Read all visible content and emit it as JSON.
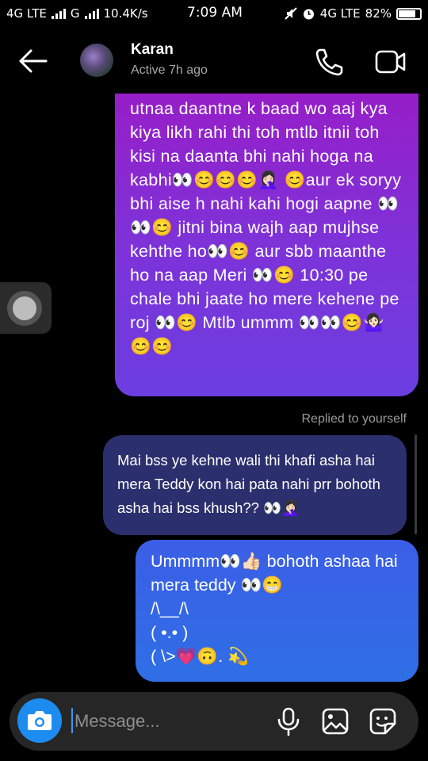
{
  "status_bar": {
    "left_network": "4G LTE",
    "left_network2": "G",
    "speed": "10.4K/s",
    "time": "7:09 AM",
    "right_network": "4G LTE",
    "battery": "82%",
    "battery_level": 0.82
  },
  "header": {
    "contact_name": "Karan",
    "contact_status": "Active 7h ago",
    "icons": [
      "back-arrow-icon",
      "phone-icon",
      "video-camera-icon"
    ]
  },
  "messages": [
    {
      "sender": "me",
      "text": "utnaa daantne k baad wo aaj kya kiya likh rahi thi toh mtlb itnii toh kisi na daanta bhi nahi hoga na kabhi👀😊😊😊🤦🏻‍♀️ 😊aur ek soryy bhi aise h nahi kahi hogi aapne 👀👀😊 jitni bina wajh aap mujhse kehthe ho👀😊 aur sbb maanthe ho na aap Meri 👀😊 10:30 pe chale bhi jaate ho mere kehene pe roj 👀😊 Mtlb ummm 👀👀😊🤷🏻‍♀️ 😊😊"
    },
    {
      "sender": "me",
      "replied_label": "Replied to yourself",
      "text": "Mai bss ye kehne wali thi khafi asha hai mera Teddy kon hai pata nahi prr bohoth asha hai bss khush?? 👀🤦🏻‍♀️"
    },
    {
      "sender": "me",
      "text": "Ummmm👀👍🏻 bohoth ashaa hai mera teddy 👀😁\n/\\__/\\\n( •.• )\n( \\>💗🙃. 💫"
    }
  ],
  "composer": {
    "placeholder": "Message...",
    "icons": [
      "camera-icon",
      "microphone-icon",
      "gallery-icon",
      "sticker-icon"
    ]
  },
  "colors": {
    "camera_button": "#1d8cf0",
    "bubble1_top": "#9a1bc6",
    "bubble1_bottom": "#6b3ee0",
    "bubble2": "#2c2f6e",
    "bubble3": "#3b5ee6"
  }
}
